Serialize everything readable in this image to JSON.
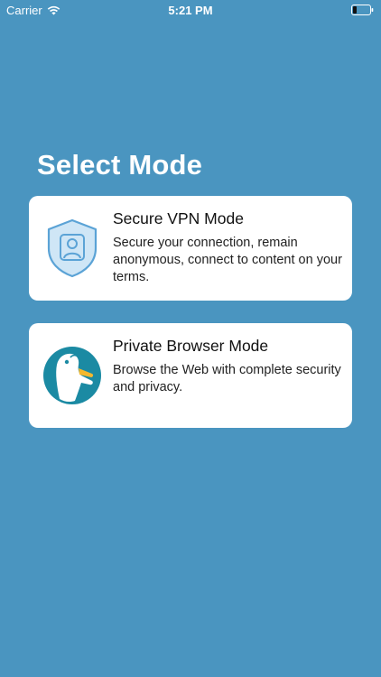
{
  "status_bar": {
    "carrier": "Carrier",
    "time": "5:21 PM",
    "wifi_icon": "wifi-icon",
    "battery_icon": "battery-icon"
  },
  "title": "Select Mode",
  "modes": [
    {
      "title": "Secure VPN Mode",
      "description": "Secure your connection, remain anonymous, connect to content on your terms.",
      "icon": "shield-user-icon"
    },
    {
      "title": "Private Browser Mode",
      "description": "Browse the Web with complete security and privacy.",
      "icon": "duck-logo-icon"
    }
  ],
  "colors": {
    "background": "#4a95c0",
    "card": "#ffffff",
    "shield_fill": "#cfe6f6",
    "shield_stroke": "#5ba3d6",
    "duck_circle": "#1b8aa3"
  }
}
